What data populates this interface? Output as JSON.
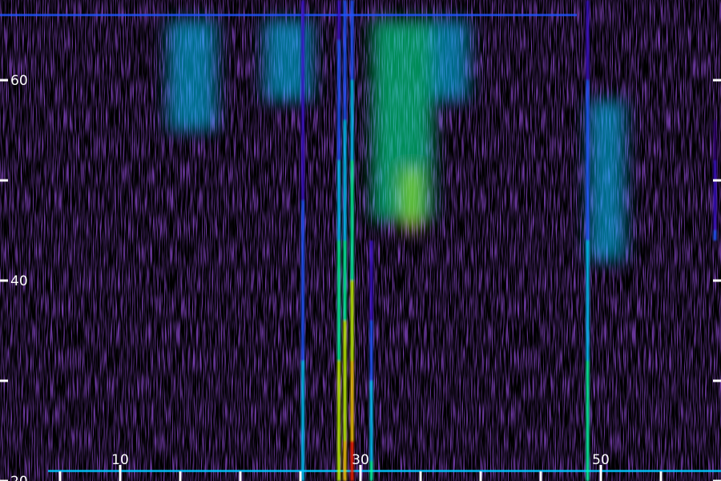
{
  "chart_data": {
    "type": "heatmap",
    "subtype": "spectrogram",
    "title": "",
    "xlabel": "",
    "ylabel": "",
    "xlim": [
      0,
      60
    ],
    "ylim": [
      20,
      68
    ],
    "x_major_ticks": [
      10,
      30,
      50
    ],
    "x_minor_ticks": [
      5,
      15,
      20,
      25,
      35,
      40,
      45,
      55
    ],
    "x_tick_labels": [
      "10",
      "30",
      "50"
    ],
    "y_major_ticks": [
      20,
      40,
      60
    ],
    "y_minor_ticks": [
      30,
      50
    ],
    "y_tick_labels": [
      "20",
      "40",
      "60"
    ],
    "colormap": [
      "#000000",
      "#2a006a",
      "#3b10c8",
      "#1f55ff",
      "#00c8ff",
      "#00ffa0",
      "#c8ff00",
      "#ffd000",
      "#ff2000"
    ],
    "background_color": "#000000",
    "noise_color": "#3a0f8c",
    "grid": false,
    "vertical_features": [
      {
        "x": 25.2,
        "y_from": 20,
        "y_to": 68,
        "peak_intensity": 0.55
      },
      {
        "x": 28.2,
        "y_from": 20,
        "y_to": 68,
        "peak_intensity": 0.85
      },
      {
        "x": 28.7,
        "y_from": 20,
        "y_to": 68,
        "peak_intensity": 0.9
      },
      {
        "x": 29.3,
        "y_from": 20,
        "y_to": 68,
        "peak_intensity": 1.0
      },
      {
        "x": 30.9,
        "y_from": 20,
        "y_to": 44,
        "peak_intensity": 0.6
      },
      {
        "x": 48.9,
        "y_from": 20,
        "y_to": 68,
        "peak_intensity": 0.7
      },
      {
        "x": 59.5,
        "y_from": 44,
        "y_to": 56,
        "peak_intensity": 0.35
      }
    ],
    "diffuse_regions": [
      {
        "x_range": [
          14,
          18
        ],
        "y_range": [
          55,
          66
        ],
        "intensity": 0.3
      },
      {
        "x_range": [
          22,
          26
        ],
        "y_range": [
          58,
          66
        ],
        "intensity": 0.3
      },
      {
        "x_range": [
          31,
          36
        ],
        "y_range": [
          46,
          66
        ],
        "intensity": 0.4
      },
      {
        "x_range": [
          33.5,
          35
        ],
        "y_range": [
          45,
          51
        ],
        "intensity": 0.5
      },
      {
        "x_range": [
          36,
          39
        ],
        "y_range": [
          58,
          66
        ],
        "intensity": 0.3
      },
      {
        "x_range": [
          49,
          52
        ],
        "y_range": [
          42,
          58
        ],
        "intensity": 0.3
      }
    ],
    "horizontal_features": [
      {
        "y": 21.0,
        "x_from": 4,
        "x_to": 60,
        "intensity": 0.45
      },
      {
        "y": 66.5,
        "x_from": 0,
        "x_to": 48,
        "intensity": 0.25
      }
    ]
  }
}
